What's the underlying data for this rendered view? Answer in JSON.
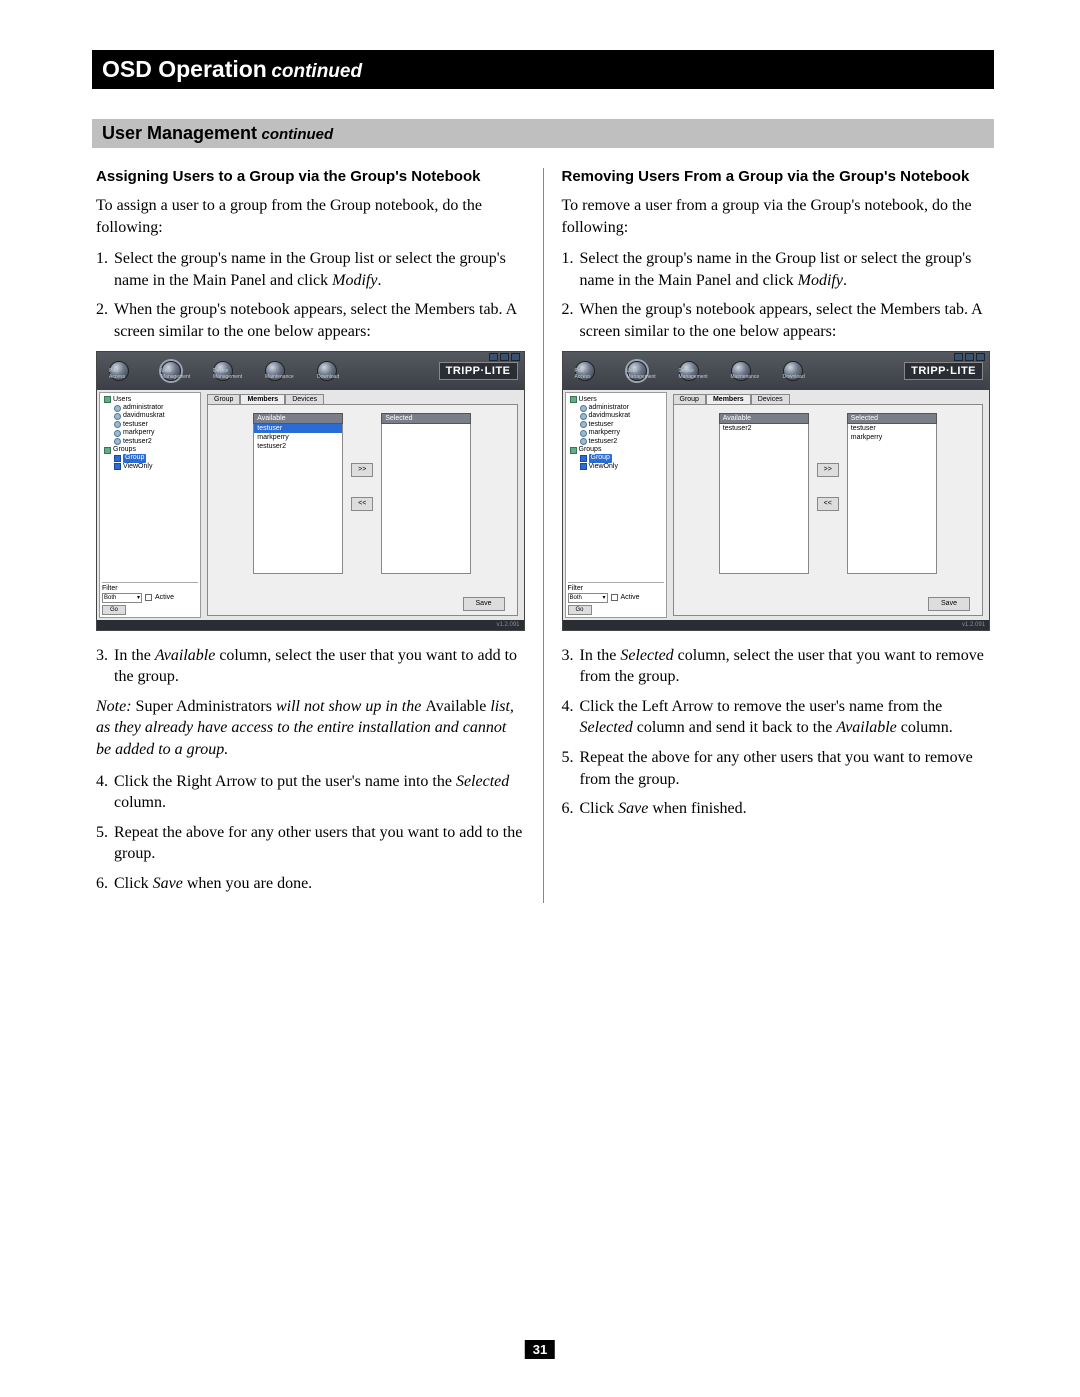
{
  "header": {
    "title": "OSD Operation",
    "continued": "continued"
  },
  "section": {
    "title": "User Management",
    "continued": "continued"
  },
  "pageNumber": "31",
  "left": {
    "subtitle": "Assigning Users to a Group via the Group's Notebook",
    "intro": "To assign a user to a group from the Group notebook, do the following:",
    "step1_a": "Select the group's name in the Group list or select the group's name in the Main Panel and click ",
    "step1_b": "Modify",
    "step1_c": ".",
    "step2": "When the group's notebook appears, select the Members tab. A screen similar to the one below appears:",
    "step3_a": "In the ",
    "step3_b": "Available",
    "step3_c": " column, select the user that you want to add to the group.",
    "note_a": "Note:",
    "note_b": " Super Administrators ",
    "note_c": "will not show up in the ",
    "note_d": "Available ",
    "note_e": "list, as they already have access to the entire installation and cannot be added to a group.",
    "step4_a": "Click the Right Arrow to put the user's name into the ",
    "step4_b": "Selected",
    "step4_c": " column.",
    "step5": "Repeat the above for any other users that you want to add to the group.",
    "step6_a": "Click ",
    "step6_b": "Save",
    "step6_c": " when you are done."
  },
  "right": {
    "subtitle": "Removing Users From a Group via the Group's Notebook",
    "intro": "To remove a user from a group via the Group's notebook, do the following:",
    "step1_a": "Select the group's name in the Group list or select the group's name in the Main Panel and click ",
    "step1_b": "Modify",
    "step1_c": ".",
    "step2": "When the group's notebook appears, select the Members tab. A screen similar to the one below appears:",
    "step3_a": "In the ",
    "step3_b": "Selected",
    "step3_c": " column, select the user that you want to remove from the group.",
    "step4_a": "Click the Left Arrow to remove the user's name from the ",
    "step4_b": "Selected",
    "step4_c": " column and send it back to the ",
    "step4_d": "Available",
    "step4_e": " column.",
    "step5": "Repeat the above for any other users that you want to remove from the group.",
    "step6_a": "Click ",
    "step6_b": "Save",
    "step6_c": " when finished."
  },
  "shot": {
    "brand": "TRIPP·LITE",
    "nav": [
      "Port Access",
      "User Management",
      "Device Management",
      "Maintenance",
      "Download"
    ],
    "tree": {
      "root": "Users",
      "users": [
        "administrator",
        "davidmuskrat",
        "testuser",
        "markperry",
        "testuser2"
      ],
      "groupsLabel": "Groups",
      "groupSel": "Group",
      "viewOnly": "ViewOnly"
    },
    "filter": {
      "label": "Filter",
      "select": "Both",
      "active": "Active",
      "go": "Go"
    },
    "tabs": [
      "Group",
      "Members",
      "Devices"
    ],
    "available": "Available",
    "selected": "Selected",
    "leftAvail": [
      "testuser",
      "markperry",
      "testuser2"
    ],
    "rightAvail": [
      "testuser2"
    ],
    "rightSelected": [
      "testuser",
      "markperry"
    ],
    "arrowR": ">>",
    "arrowL": "<<",
    "save": "Save",
    "status": "v1.2.091"
  }
}
